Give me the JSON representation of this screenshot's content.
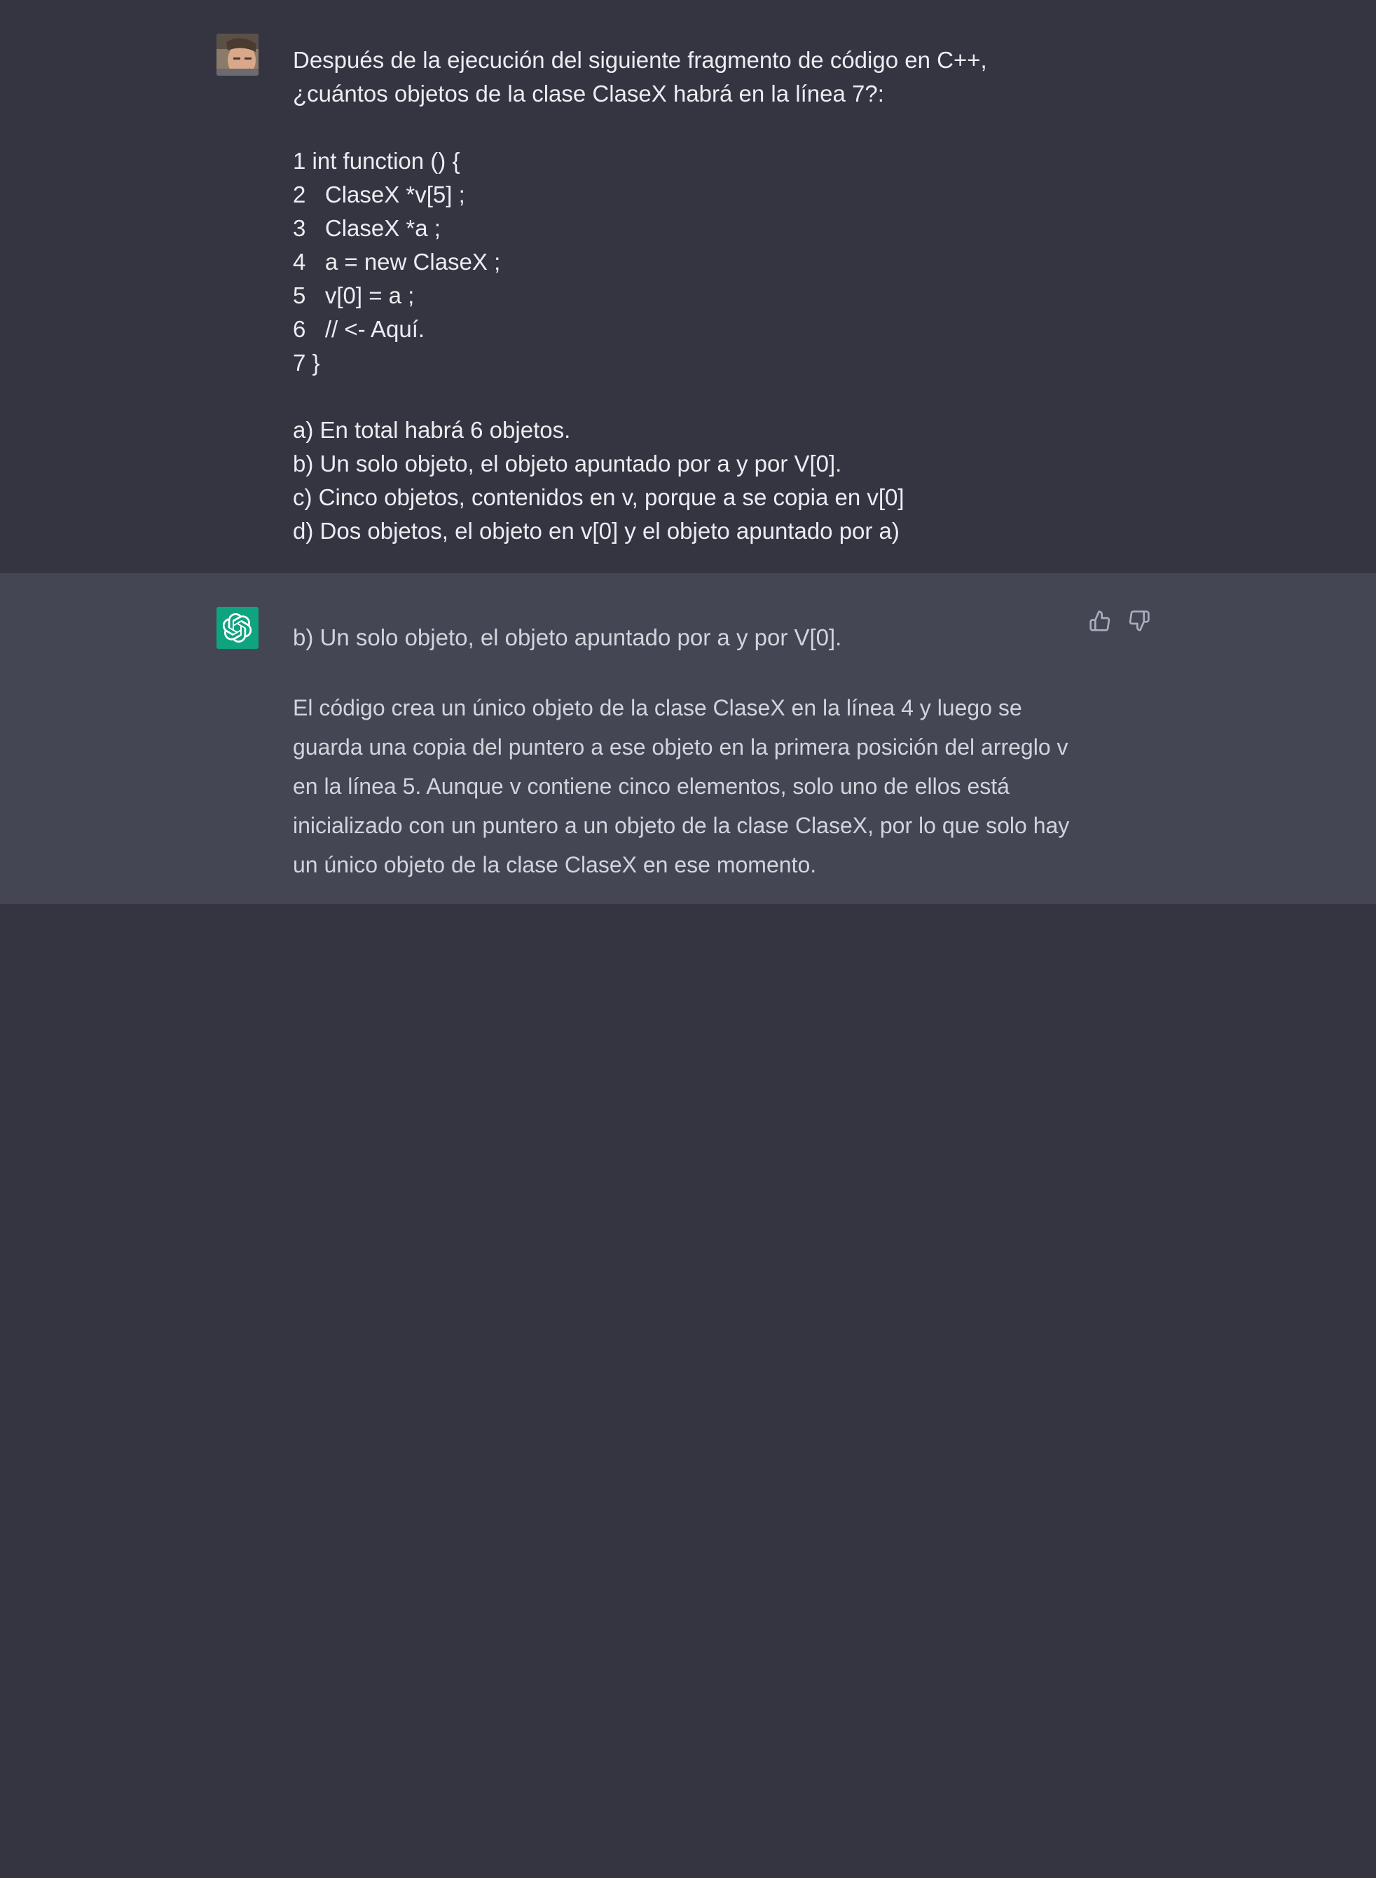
{
  "user_turn": {
    "avatar_icon": "user-photo-avatar",
    "question_lines": [
      "Después de la ejecución del siguiente fragmento de código en C++,",
      "¿cuántos objetos de la clase ClaseX habrá en la línea 7?:"
    ],
    "code_lines": [
      "1 int function () {",
      "2   ClaseX *v[5] ;",
      "3   ClaseX *a ;",
      "4   a = new ClaseX ;",
      "5   v[0] = a ;",
      "6   // <- Aquí.",
      "7 }"
    ],
    "options": [
      "a) En total habrá 6 objetos.",
      "b) Un solo objeto, el objeto apuntado por a y por V[0].",
      "c) Cinco objetos, contenidos en v, porque a se copia en v[0]",
      "d) Dos objetos, el objeto en v[0] y el objeto apuntado por a)"
    ]
  },
  "assistant_turn": {
    "avatar_icon": "openai-logo-icon",
    "avatar_color": "#10a37f",
    "answer_head": "b) Un solo objeto, el objeto apuntado por a y por V[0].",
    "answer_body": "El código crea un único objeto de la clase ClaseX en la línea 4 y luego se guarda una copia del puntero a ese objeto en la primera posición del arreglo v en la línea 5. Aunque v contiene cinco elementos, solo uno de ellos está inicializado con un puntero a un objeto de la clase ClaseX, por lo que solo hay un único objeto de la clase ClaseX en ese momento.",
    "feedback": {
      "thumbs_up_icon": "thumbs-up-icon",
      "thumbs_down_icon": "thumbs-down-icon"
    }
  },
  "colors": {
    "page_bg": "#343541",
    "assistant_bg": "#444654",
    "user_text": "#ececf1",
    "assistant_text": "#d1d5db",
    "icon_gray": "#acacbe"
  }
}
